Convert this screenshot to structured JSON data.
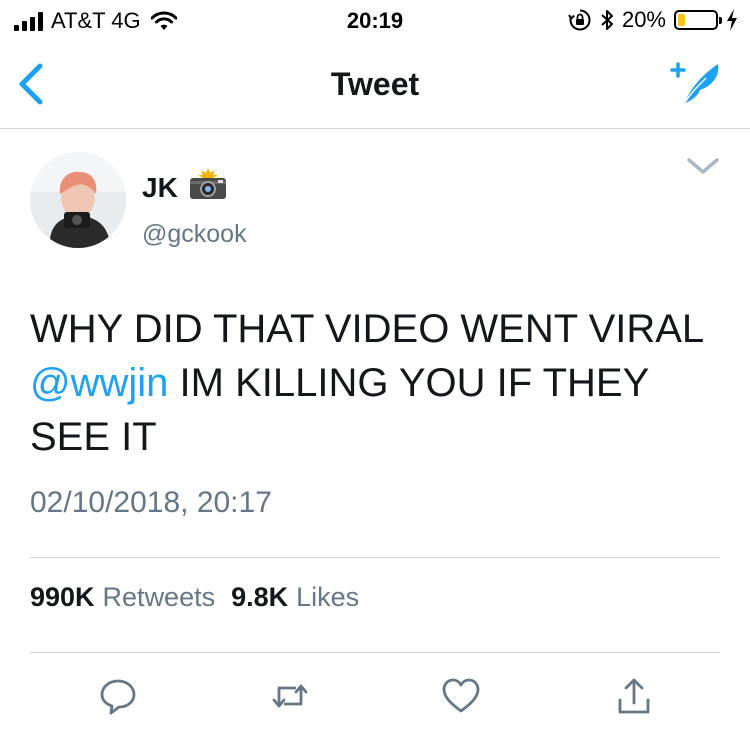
{
  "status_bar": {
    "carrier": "AT&T 4G",
    "time": "20:19",
    "battery_percent": "20%",
    "battery_level": 0.2,
    "icons": [
      "signal-bars-icon",
      "wifi-icon",
      "orientation-lock-icon",
      "bluetooth-icon",
      "battery-icon",
      "charging-bolt-icon"
    ]
  },
  "nav": {
    "title": "Tweet",
    "back_icon": "chevron-left-icon",
    "compose_icon": "compose-feather-icon"
  },
  "tweet": {
    "author": {
      "name": "JK",
      "name_emoji": "camera-with-flash",
      "handle": "@gckook"
    },
    "text": {
      "line1": "WHY DID THAT VIDEO WENT VIRAL",
      "mention": "@wwjin",
      "line2_rest": " IM KILLING YOU IF THEY",
      "line3": "SEE IT"
    },
    "timestamp": "02/10/2018, 20:17",
    "stats": {
      "retweets_count": "990K",
      "retweets_label": "Retweets",
      "likes_count": "9.8K",
      "likes_label": "Likes"
    },
    "actions": [
      "reply-icon",
      "retweet-icon",
      "like-icon",
      "share-icon"
    ]
  },
  "colors": {
    "accent": "#1da1f2",
    "text_primary": "#14171a",
    "text_secondary": "#657786",
    "divider": "#d0d5d9",
    "battery_fill": "#f5c518"
  }
}
